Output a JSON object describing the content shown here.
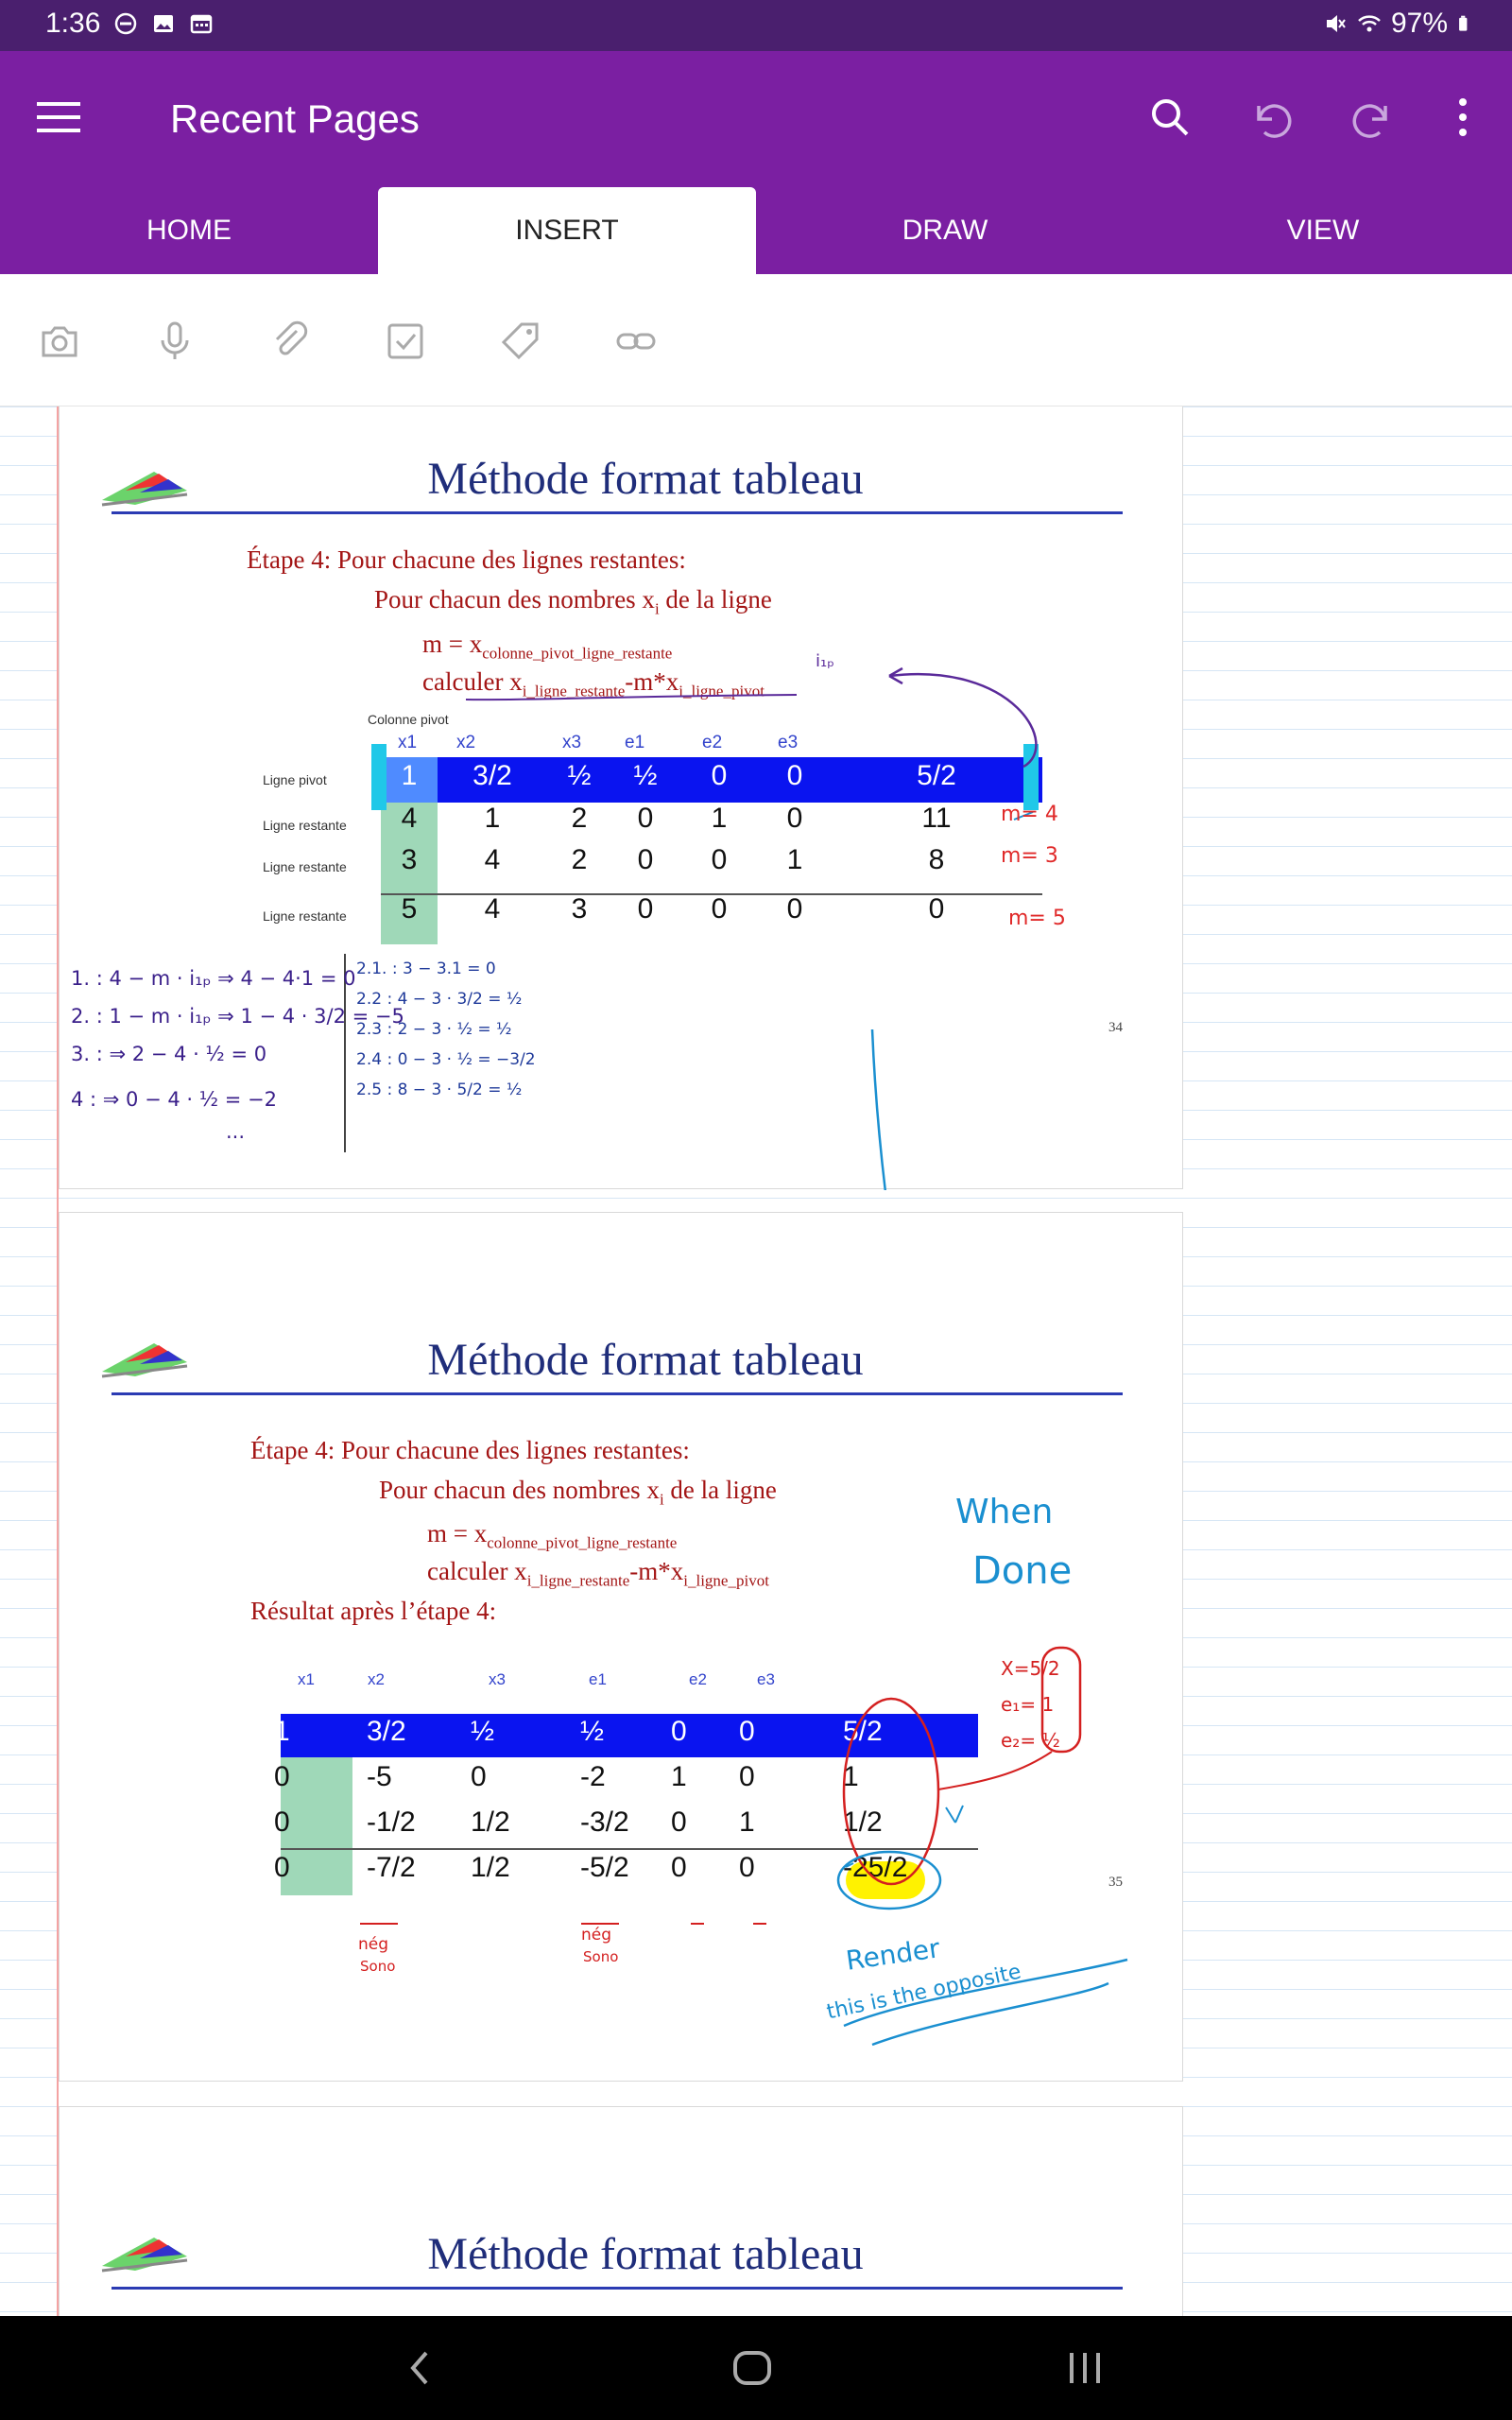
{
  "status": {
    "time": "1:36",
    "battery": "97%"
  },
  "appbar": {
    "title": "Recent Pages"
  },
  "tabs": [
    "HOME",
    "INSERT",
    "DRAW",
    "VIEW"
  ],
  "slide1": {
    "title": "Méthode format tableau",
    "step": "Étape 4: Pour chacune des lignes restantes:",
    "line2": "Pour chacun des nombres x",
    "line2_sub": "i",
    "line2_end": " de la ligne",
    "m_prefix": "m = x",
    "m_sub": "colonne_pivot_ligne_restante",
    "calc_prefix": "calculer x",
    "calc_sub1": "i_ligne_restante",
    "calc_mid": "-m*x",
    "calc_sub2": "i_ligne_pivot",
    "colonne_pivot": "Colonne pivot",
    "headers": [
      "x1",
      "x2",
      "x3",
      "e1",
      "e2",
      "e3"
    ],
    "row_labels": [
      "Ligne pivot",
      "Ligne restante",
      "Ligne restante",
      "Ligne restante"
    ],
    "rows": [
      [
        "1",
        "3/2",
        "½",
        "½",
        "0",
        "0",
        "5/2"
      ],
      [
        "4",
        "1",
        "2",
        "0",
        "1",
        "0",
        "11"
      ],
      [
        "3",
        "4",
        "2",
        "0",
        "0",
        "1",
        "8"
      ],
      [
        "5",
        "4",
        "3",
        "0",
        "0",
        "0",
        "0"
      ]
    ],
    "page": "34",
    "ink": {
      "m_vals": [
        "m= 4",
        "m= 3",
        "m= 5"
      ],
      "purple_lines": [
        "1. : 4 − m · i₁ₚ ⇒ 4 − 4·1 = 0",
        "2. : 1 − m · i₁ₚ ⇒ 1 − 4 · 3/2 = −5",
        "3. : ⇒ 2 − 4 · ½ = 0",
        "4 : ⇒ 0 − 4 · ½ = −2",
        "..."
      ],
      "blue_lines": [
        "2.1. : 3 − 3.1 = 0",
        "2.2 : 4 − 3 · 3/2 = ½",
        "2.3 : 2 − 3 · ½ = ½",
        "2.4 : 0 − 3 · ½ = −3/2",
        "2.5 : 8 − 3 · 5/2 = ½"
      ],
      "i1p": "i₁ₚ"
    }
  },
  "slide2": {
    "title": "Méthode format tableau",
    "step": "Étape 4: Pour chacune des lignes restantes:",
    "line2": "Pour chacun des nombres x",
    "line2_sub": "i",
    "line2_end": " de la ligne",
    "m_prefix": "m = x",
    "m_sub": "colonne_pivot_ligne_restante",
    "calc_prefix": "calculer x",
    "calc_sub1": "i_ligne_restante",
    "calc_mid": "-m*x",
    "calc_sub2": "i_ligne_pivot",
    "result": "Résultat après l’étape 4:",
    "headers": [
      "x1",
      "x2",
      "x3",
      "e1",
      "e2",
      "e3"
    ],
    "rows": [
      [
        "1",
        "3/2",
        "½",
        "½",
        "0",
        "0",
        "5/2"
      ],
      [
        "0",
        "-5",
        "0",
        "-2",
        "1",
        "0",
        "1"
      ],
      [
        "0",
        "-1/2",
        "1/2",
        "-3/2",
        "0",
        "1",
        "1/2"
      ],
      [
        "0",
        "-7/2",
        "1/2",
        "-5/2",
        "0",
        "0",
        "-25/2"
      ]
    ],
    "page": "35",
    "ink": {
      "when_done": [
        "When",
        "Done"
      ],
      "solution": [
        "X=5/2",
        "e₁= 1",
        "e₂= ½"
      ],
      "neg1": [
        "nég",
        "Sono"
      ],
      "neg2": [
        "nég",
        "Sono"
      ],
      "render": [
        "Render",
        "this is the opposite"
      ]
    }
  },
  "slide3": {
    "title": "Méthode format tableau"
  }
}
